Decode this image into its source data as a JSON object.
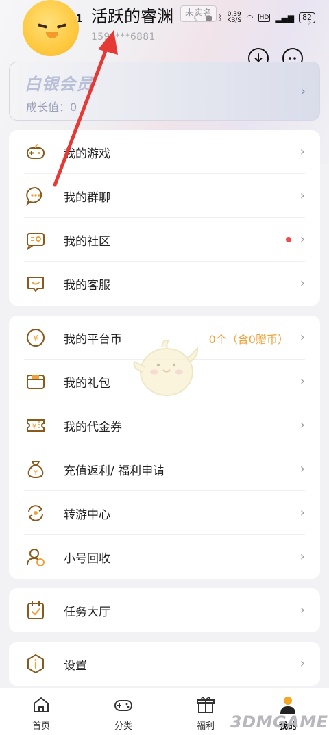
{
  "status_bar": {
    "time": "14:31",
    "network_speed": "0.39\nKB/S",
    "battery": "82"
  },
  "profile": {
    "username": "活跃的睿渊",
    "phone": "159****6881",
    "realname_tag": "未实名"
  },
  "member_card": {
    "title": "白银会员",
    "growth_label": "成长值：0"
  },
  "group1": [
    {
      "label": "我的游戏",
      "icon": "gamepad-icon"
    },
    {
      "label": "我的群聊",
      "icon": "chat-bubble-icon"
    },
    {
      "label": "我的社区",
      "icon": "community-icon",
      "badge": true
    },
    {
      "label": "我的客服",
      "icon": "customer-service-icon"
    }
  ],
  "group2": [
    {
      "label": "我的平台币",
      "icon": "coin-icon",
      "value": "0个（含0赠币）"
    },
    {
      "label": "我的礼包",
      "icon": "gift-card-icon"
    },
    {
      "label": "我的代金券",
      "icon": "voucher-icon"
    },
    {
      "label": "充值返利/ 福利申请",
      "icon": "money-bag-icon"
    },
    {
      "label": "转游中心",
      "icon": "transfer-icon"
    },
    {
      "label": "小号回收",
      "icon": "user-recycle-icon"
    }
  ],
  "group3": [
    {
      "label": "任务大厅",
      "icon": "task-icon"
    }
  ],
  "group4": [
    {
      "label": "设置",
      "icon": "settings-icon"
    }
  ],
  "tabbar": [
    {
      "label": "首页",
      "icon": "home-icon"
    },
    {
      "label": "分类",
      "icon": "category-gamepad-icon"
    },
    {
      "label": "福利",
      "icon": "gift-icon"
    },
    {
      "label": "我的",
      "icon": "profile-icon",
      "active": true
    }
  ],
  "watermark": "3DMGAME",
  "colors": {
    "accent": "#f0a23a",
    "icon_brown": "#8a5a1c",
    "badge_red": "#ef4b4b",
    "arrow_red": "#e53935"
  }
}
